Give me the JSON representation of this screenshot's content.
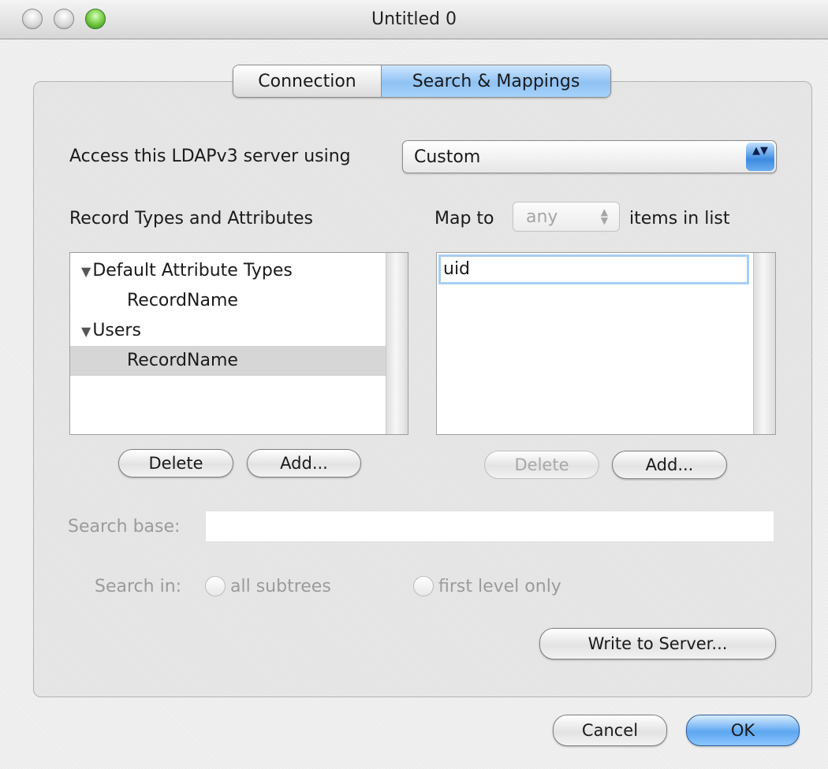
{
  "window": {
    "title": "Untitled 0"
  },
  "tabs": {
    "connection": "Connection",
    "search_mappings": "Search & Mappings"
  },
  "access": {
    "label": "Access this LDAPv3 server using",
    "selected": "Custom"
  },
  "record_types": {
    "heading": "Record Types and Attributes",
    "rows": [
      {
        "label": "Default Attribute Types",
        "expanded": true
      },
      {
        "label": "RecordName"
      },
      {
        "label": "Users",
        "expanded": true
      },
      {
        "label": "RecordName",
        "selected": true
      }
    ],
    "delete_label": "Delete",
    "add_label": "Add..."
  },
  "mapping": {
    "map_to_label": "Map to",
    "map_to_selected": "any",
    "items_in_list_label": "items in list",
    "values": [
      "uid"
    ],
    "delete_label": "Delete",
    "add_label": "Add..."
  },
  "search_base": {
    "label": "Search base:",
    "value": ""
  },
  "search_in": {
    "label": "Search in:",
    "all_subtrees": "all subtrees",
    "first_level_only": "first level only"
  },
  "write_to_server_label": "Write to Server...",
  "footer": {
    "cancel_label": "Cancel",
    "ok_label": "OK"
  },
  "icons": {
    "disclosure": "▼",
    "popup_arrows": "▲▼"
  }
}
